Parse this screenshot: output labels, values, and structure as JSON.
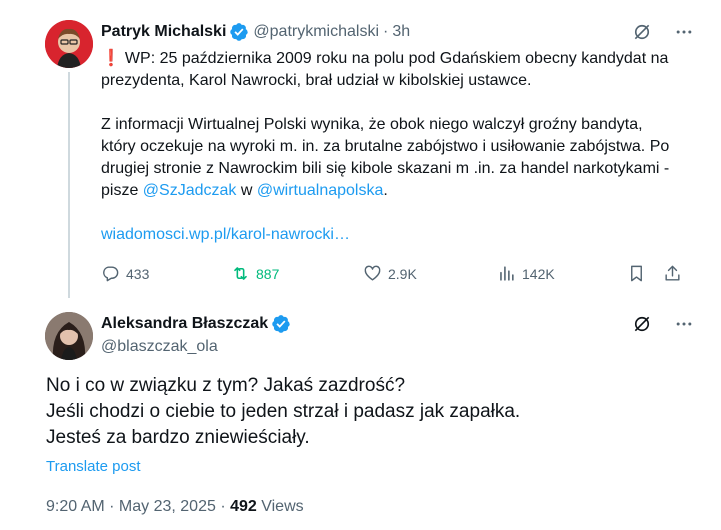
{
  "tweet1": {
    "author_name": "Patryk Michalski",
    "handle": "@patrykmichalski",
    "separator": "·",
    "time": "3h",
    "emoji": "❗",
    "paragraph1": "WP: 25 października 2009 roku na polu pod Gdańskiem obecny kandydat na prezydenta, Karol Nawrocki, brał udział w kibolskiej ustawce.",
    "paragraph2_text": "Z informacji Wirtualnej Polski wynika, że obok niego walczył groźny bandyta, który oczekuje na wyroki m. in. za brutalne zabójstwo i usiłowanie zabójstwa. Po drugiej stronie z Nawrockim bili się kibole skazani m .in. za handel narkotykami - pisze ",
    "mention1": "@SzJadczak",
    "connector": " w ",
    "mention2": "@wirtualnapolska",
    "period": ".",
    "link": "wiadomosci.wp.pl/karol-nawrocki…",
    "actions": {
      "replies": "433",
      "reposts": "887",
      "likes": "2.9K",
      "views": "142K"
    }
  },
  "tweet2": {
    "author_name": "Aleksandra Błaszczak",
    "handle": "@blaszczak_ola",
    "lines": [
      "No i co w związku z tym? Jakaś zazdrość?",
      "Jeśli chodzi o ciebie to jeden strzał i padasz jak zapałka.",
      "Jesteś za bardzo zniewieściały."
    ],
    "translate_label": "Translate post",
    "timestamp": "9:20 AM · May 23, 2025 · ",
    "views_count": "492",
    "views_label": " Views"
  },
  "colors": {
    "accent": "#1d9bf0",
    "repost_active": "#00ba7c",
    "secondary_text": "#536471",
    "primary_text": "#0f1419",
    "thread_line": "#cfd9de"
  },
  "icons": [
    "verified-badge-icon",
    "grok-icon",
    "more-icon",
    "reply-icon",
    "repost-icon",
    "like-icon",
    "views-icon",
    "bookmark-icon",
    "share-icon"
  ]
}
